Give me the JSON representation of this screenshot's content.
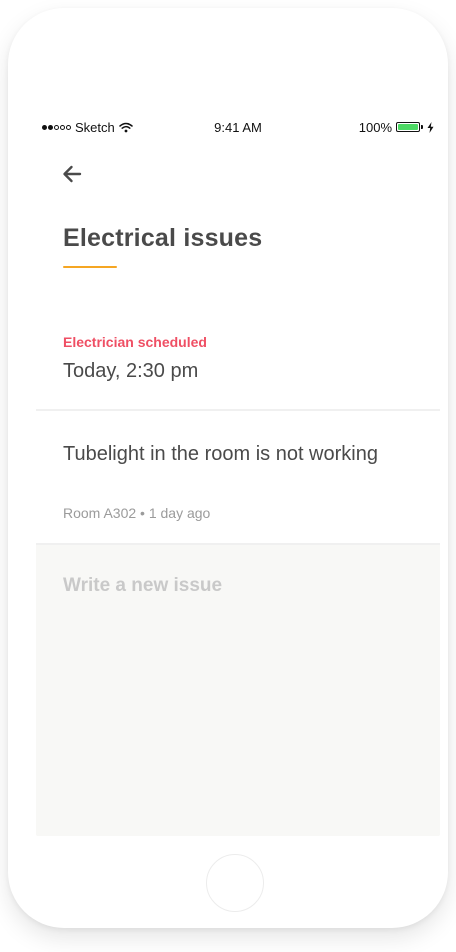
{
  "status_bar": {
    "carrier": "Sketch",
    "time": "9:41 AM",
    "battery_percent": "100%",
    "battery_level": 1.0,
    "battery_color": "#4cd964",
    "signal_bars_filled": 2,
    "signal_bars_total": 5,
    "icons": [
      "wifi-icon",
      "battery-icon",
      "charging-bolt-icon"
    ]
  },
  "header": {
    "back_icon": "arrow-left-icon",
    "title": "Electrical issues",
    "underline_color": "#f5a623"
  },
  "schedule": {
    "label": "Electrician scheduled",
    "label_color": "#ef4f64",
    "time": "Today, 2:30 pm"
  },
  "issues": [
    {
      "title": "Tubelight in the room is not working",
      "meta": "Room A302 • 1 day ago"
    }
  ],
  "new_issue": {
    "placeholder": "Write a new issue",
    "value": ""
  }
}
